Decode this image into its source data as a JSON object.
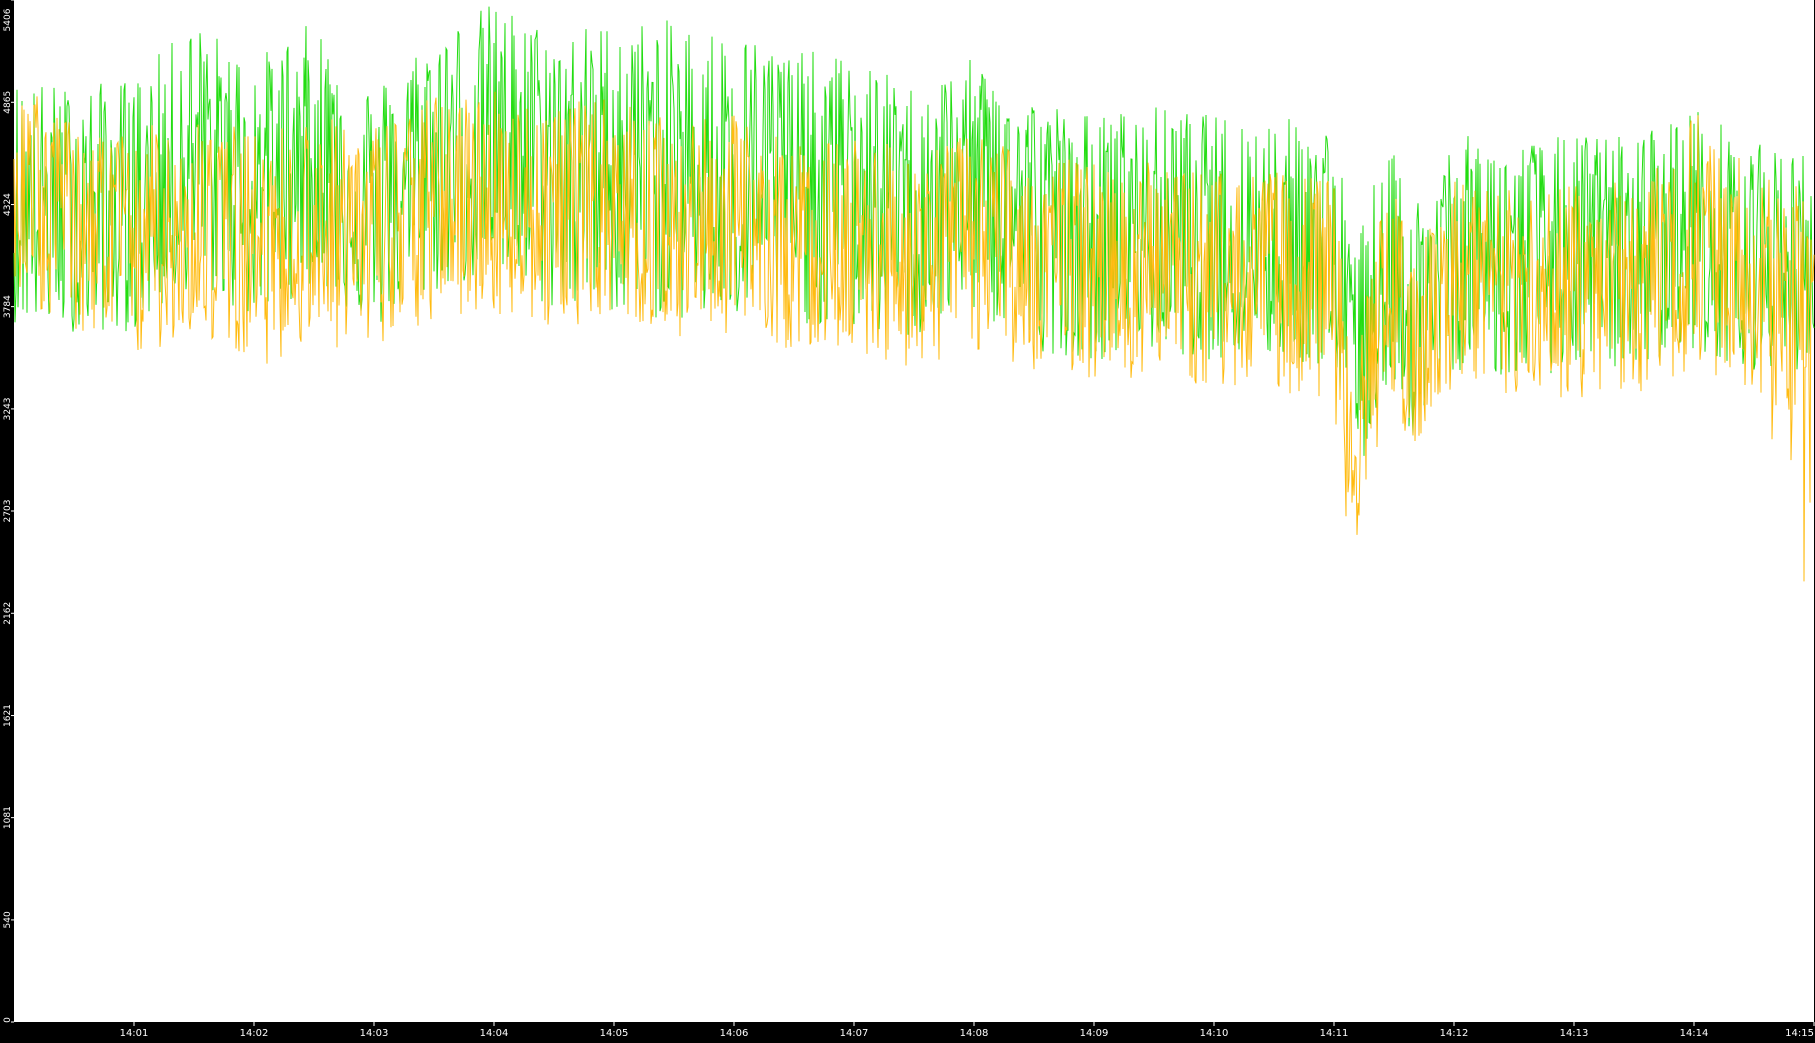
{
  "chart_data": {
    "type": "line",
    "title": "",
    "xlabel": "",
    "ylabel": "",
    "ylim": [
      0,
      5406
    ],
    "xlim_seconds": [
      0,
      900
    ],
    "y_ticks": [
      "0",
      "540",
      "1081",
      "1621",
      "2162",
      "2703",
      "3243",
      "3784",
      "4324",
      "4865",
      "5406"
    ],
    "y_tick_values": [
      0,
      540,
      1081,
      1621,
      2162,
      2703,
      3243,
      3784,
      4324,
      4865,
      5406
    ],
    "x_ticks": [
      "14:01",
      "14:02",
      "14:03",
      "14:04",
      "14:05",
      "14:06",
      "14:07",
      "14:08",
      "14:09",
      "14:10",
      "14:11",
      "14:12",
      "14:13",
      "14:14",
      "14:15"
    ],
    "x_tick_seconds": [
      60,
      120,
      180,
      240,
      300,
      360,
      420,
      480,
      540,
      600,
      660,
      720,
      780,
      840,
      900
    ],
    "background_color": "#ffffff",
    "axis_band_color": "#000000",
    "tick_label_color": "#ffffff",
    "grid": false,
    "series": [
      {
        "color": "#22dd11",
        "x_seconds": [
          0,
          30,
          60,
          90,
          120,
          150,
          180,
          210,
          240,
          270,
          300,
          330,
          360,
          390,
          420,
          450,
          480,
          510,
          540,
          570,
          600,
          630,
          660,
          670,
          680,
          690,
          700,
          720,
          750,
          780,
          810,
          840,
          870,
          900
        ],
        "values": [
          4300,
          4250,
          4250,
          4550,
          4400,
          4600,
          4250,
          4550,
          4650,
          4500,
          4550,
          4550,
          4500,
          4450,
          4400,
          4300,
          4450,
          4250,
          4150,
          4200,
          4100,
          4150,
          4100,
          3300,
          3800,
          4000,
          3700,
          4050,
          4000,
          4050,
          4050,
          4150,
          4050,
          4000
        ],
        "range_low": [
          3700,
          3650,
          3650,
          3900,
          3700,
          3900,
          3650,
          3850,
          3950,
          3750,
          3750,
          3700,
          3700,
          3700,
          3650,
          3600,
          3750,
          3550,
          3500,
          3550,
          3500,
          3500,
          3450,
          2700,
          3200,
          3400,
          3050,
          3450,
          3400,
          3450,
          3450,
          3550,
          3450,
          3450
        ],
        "range_high": [
          5000,
          4950,
          5000,
          5300,
          5100,
          5300,
          4950,
          5250,
          5400,
          5250,
          5300,
          5300,
          5250,
          5150,
          5100,
          4950,
          5100,
          4900,
          4800,
          4850,
          4800,
          4800,
          4750,
          4100,
          4450,
          4600,
          4350,
          4700,
          4650,
          4700,
          4700,
          4850,
          4650,
          4600
        ]
      },
      {
        "color": "#ffbb11",
        "x_seconds": [
          0,
          30,
          60,
          90,
          120,
          150,
          180,
          210,
          240,
          270,
          300,
          330,
          360,
          390,
          420,
          450,
          480,
          510,
          540,
          570,
          600,
          630,
          660,
          670,
          680,
          690,
          700,
          720,
          750,
          780,
          810,
          840,
          870,
          900
        ],
        "values": [
          4400,
          4200,
          4100,
          4250,
          4100,
          4200,
          4150,
          4300,
          4350,
          4250,
          4350,
          4200,
          4250,
          4100,
          4150,
          4050,
          4150,
          4050,
          4000,
          4000,
          3950,
          3950,
          3900,
          2700,
          3600,
          3850,
          3600,
          3900,
          3850,
          3900,
          3900,
          4050,
          3950,
          3850
        ],
        "range_low": [
          3850,
          3650,
          3500,
          3650,
          3450,
          3600,
          3500,
          3700,
          3750,
          3650,
          3750,
          3600,
          3650,
          3550,
          3550,
          3450,
          3550,
          3450,
          3400,
          3400,
          3350,
          3350,
          3250,
          2100,
          3000,
          3250,
          3000,
          3300,
          3250,
          3300,
          3300,
          3450,
          3350,
          2050
        ],
        "range_high": [
          5000,
          4750,
          4700,
          4850,
          4700,
          4800,
          4750,
          4900,
          4950,
          4850,
          4900,
          4750,
          4800,
          4650,
          4700,
          4600,
          4700,
          4600,
          4550,
          4550,
          4500,
          4500,
          4450,
          3300,
          4200,
          4400,
          4150,
          4450,
          4400,
          4450,
          4450,
          4850,
          4500,
          4400
        ]
      }
    ]
  }
}
